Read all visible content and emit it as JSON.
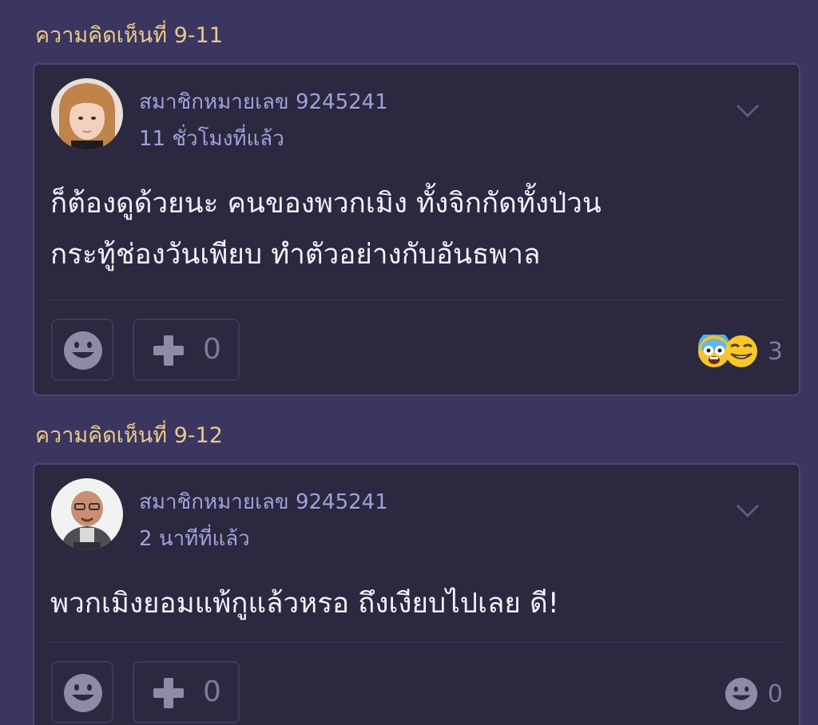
{
  "comments": [
    {
      "label": "ความคิดเห็นที่ 9-11",
      "username": "สมาชิกหมายเลข 9245241",
      "time": "11 ชั่วโมงที่แล้ว",
      "text_lines": [
        "ก็ต้องดูด้วยนะ คนของพวกเมิง ทั้งจิกกัดทั้งป่วน",
        "กระทู้ช่องวันเพียบ ทำตัวอย่างกับอันธพาล"
      ],
      "plus_count": "0",
      "reactions": [
        "shocked-emoji-icon",
        "smirk-emoji-icon"
      ],
      "reaction_count": "3"
    },
    {
      "label": "ความคิดเห็นที่ 9-12",
      "username": "สมาชิกหมายเลข 9245241",
      "time": "2 นาทีที่แล้ว",
      "text_lines": [
        "พวกเมิงยอมแพ้กูแล้วหรอ ถึงเงียบไปเลย ดี!"
      ],
      "plus_count": "0",
      "reactions": [
        "smile-emoji-icon"
      ],
      "reaction_count": "0"
    }
  ],
  "colors": {
    "background": "#3b3660",
    "card": "#2b283f",
    "label": "#e9c98a",
    "meta": "#9fa2dc"
  }
}
